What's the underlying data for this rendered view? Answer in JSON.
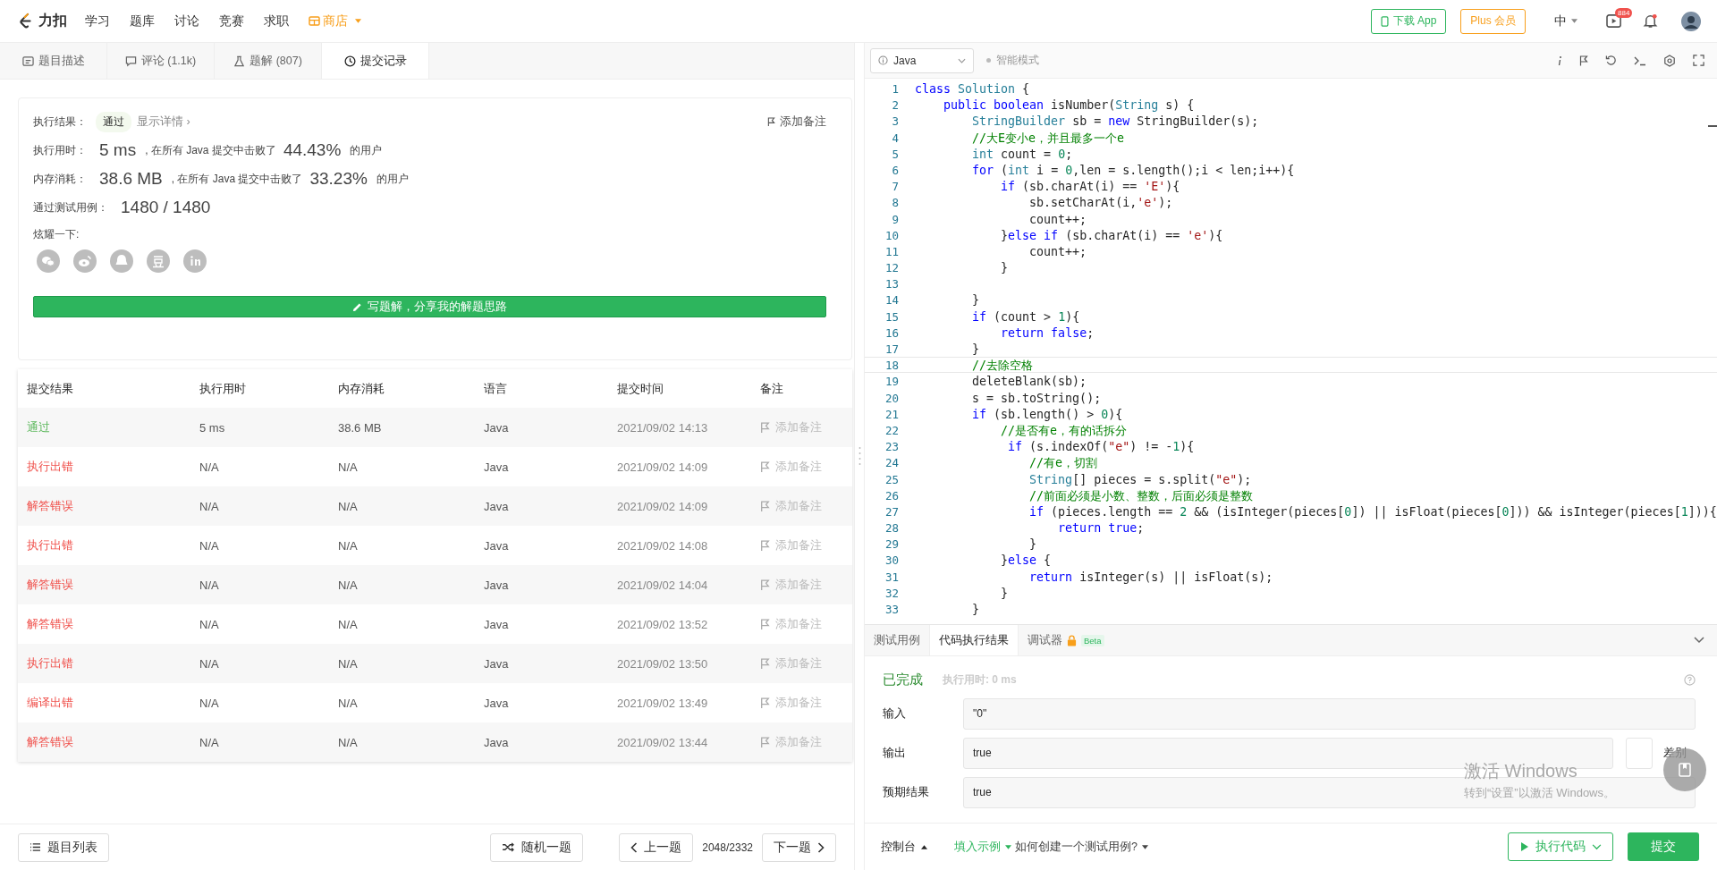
{
  "top_nav": {
    "brand": "力扣",
    "links": [
      {
        "label": "学习",
        "kind": "link"
      },
      {
        "label": "题库",
        "kind": "link"
      },
      {
        "label": "讨论",
        "kind": "link"
      },
      {
        "label": "竞赛",
        "kind": "link"
      },
      {
        "label": "求职",
        "kind": "link"
      },
      {
        "label": "商店",
        "kind": "store"
      }
    ],
    "download_button": "下载 App",
    "plus_button": "Plus 会员",
    "language": "中",
    "notification_badge": "884"
  },
  "problem_tabs": [
    {
      "label": "题目描述",
      "selected": false
    },
    {
      "label": "评论 (1.1k)",
      "selected": false
    },
    {
      "label": "题解 (807)",
      "selected": false
    },
    {
      "label": "提交记录",
      "selected": true
    }
  ],
  "result_card": {
    "result_label": "执行结果：",
    "result_badge": "通过",
    "details_link": "显示详情 ›",
    "note_link": "添加备注",
    "stats": [
      {
        "label": "执行用时：",
        "value": "5 ms",
        "middle": ", 在所有 Java 提交中击败了",
        "percent": "44.43%",
        "suffix": "的用户"
      },
      {
        "label": "内存消耗：",
        "value": "38.6 MB",
        "middle": ", 在所有 Java 提交中击败了",
        "percent": "33.23%",
        "suffix": "的用户"
      }
    ],
    "cases_label": "通过测试用例：",
    "cases_value": "1480 / 1480",
    "share_label": "炫耀一下:",
    "write_button": "写题解，分享我的解题思路"
  },
  "submissions": {
    "columns": [
      "提交结果",
      "执行用时",
      "内存消耗",
      "语言",
      "提交时间",
      "备注"
    ],
    "rows": [
      {
        "status": "通过",
        "color": "#5cb85c",
        "time": "5 ms",
        "memory": "38.6 MB",
        "language": "Java",
        "submitted": "2021/09/02 14:13",
        "note": "添加备注"
      },
      {
        "status": "执行出错",
        "color": "#f0514c",
        "time": "N/A",
        "memory": "N/A",
        "language": "Java",
        "submitted": "2021/09/02 14:09",
        "note": "添加备注"
      },
      {
        "status": "解答错误",
        "color": "#f0514c",
        "time": "N/A",
        "memory": "N/A",
        "language": "Java",
        "submitted": "2021/09/02 14:09",
        "note": "添加备注"
      },
      {
        "status": "执行出错",
        "color": "#f0514c",
        "time": "N/A",
        "memory": "N/A",
        "language": "Java",
        "submitted": "2021/09/02 14:08",
        "note": "添加备注"
      },
      {
        "status": "解答错误",
        "color": "#f0514c",
        "time": "N/A",
        "memory": "N/A",
        "language": "Java",
        "submitted": "2021/09/02 14:04",
        "note": "添加备注"
      },
      {
        "status": "解答错误",
        "color": "#f0514c",
        "time": "N/A",
        "memory": "N/A",
        "language": "Java",
        "submitted": "2021/09/02 13:52",
        "note": "添加备注"
      },
      {
        "status": "执行出错",
        "color": "#f0514c",
        "time": "N/A",
        "memory": "N/A",
        "language": "Java",
        "submitted": "2021/09/02 13:50",
        "note": "添加备注"
      },
      {
        "status": "编译出错",
        "color": "#f0514c",
        "time": "N/A",
        "memory": "N/A",
        "language": "Java",
        "submitted": "2021/09/02 13:49",
        "note": "添加备注"
      },
      {
        "status": "解答错误",
        "color": "#f0514c",
        "time": "N/A",
        "memory": "N/A",
        "language": "Java",
        "submitted": "2021/09/02 13:44",
        "note": "添加备注"
      }
    ]
  },
  "left_footer": {
    "list_button": "题目列表",
    "random_button": "随机一题",
    "prev_button": "上一题",
    "position": "2048/2332",
    "next_button": "下一题"
  },
  "editor": {
    "language": "Java",
    "mode": "智能模式",
    "lines": [
      {
        "number": "1",
        "current": false,
        "tokens": [
          {
            "kind": "keyword",
            "text": "class"
          },
          {
            "kind": "type",
            "text": " Solution"
          },
          {
            "kind": "plain",
            "text": " {"
          }
        ]
      },
      {
        "number": "2",
        "current": false,
        "tokens": [
          {
            "kind": "keyword",
            "text": "    public"
          },
          {
            "kind": "keyword",
            "text": " boolean"
          },
          {
            "kind": "plain",
            "text": " isNumber("
          },
          {
            "kind": "type",
            "text": "String"
          },
          {
            "kind": "plain",
            "text": " s) {"
          }
        ]
      },
      {
        "number": "3",
        "current": false,
        "tokens": [
          {
            "kind": "type",
            "text": "        StringBuilder"
          },
          {
            "kind": "plain",
            "text": " sb = "
          },
          {
            "kind": "keyword",
            "text": "new"
          },
          {
            "kind": "plain",
            "text": " StringBuilder(s);"
          }
        ]
      },
      {
        "number": "4",
        "current": false,
        "tokens": [
          {
            "kind": "comment",
            "text": "        //大E变小e，并且最多一个e"
          }
        ]
      },
      {
        "number": "5",
        "current": false,
        "tokens": [
          {
            "kind": "type",
            "text": "        int"
          },
          {
            "kind": "plain",
            "text": " count = "
          },
          {
            "kind": "number",
            "text": "0"
          },
          {
            "kind": "plain",
            "text": ";"
          }
        ]
      },
      {
        "number": "6",
        "current": false,
        "tokens": [
          {
            "kind": "keyword",
            "text": "        for"
          },
          {
            "kind": "plain",
            "text": " ("
          },
          {
            "kind": "type",
            "text": "int"
          },
          {
            "kind": "plain",
            "text": " i = "
          },
          {
            "kind": "number",
            "text": "0"
          },
          {
            "kind": "plain",
            "text": ",len = s.length();i < len;i++){"
          }
        ]
      },
      {
        "number": "7",
        "current": false,
        "tokens": [
          {
            "kind": "keyword",
            "text": "            if"
          },
          {
            "kind": "plain",
            "text": " (sb.charAt(i) == "
          },
          {
            "kind": "string",
            "text": "'E'"
          },
          {
            "kind": "plain",
            "text": "){"
          }
        ]
      },
      {
        "number": "8",
        "current": false,
        "tokens": [
          {
            "kind": "plain",
            "text": "                sb.setCharAt(i,"
          },
          {
            "kind": "string",
            "text": "'e'"
          },
          {
            "kind": "plain",
            "text": ");"
          }
        ]
      },
      {
        "number": "9",
        "current": false,
        "tokens": [
          {
            "kind": "plain",
            "text": "                count++;"
          }
        ]
      },
      {
        "number": "10",
        "current": false,
        "tokens": [
          {
            "kind": "plain",
            "text": "            }"
          },
          {
            "kind": "keyword",
            "text": "else"
          },
          {
            "kind": "keyword",
            "text": " if"
          },
          {
            "kind": "plain",
            "text": " (sb.charAt(i) == "
          },
          {
            "kind": "string",
            "text": "'e'"
          },
          {
            "kind": "plain",
            "text": "){"
          }
        ]
      },
      {
        "number": "11",
        "current": false,
        "tokens": [
          {
            "kind": "plain",
            "text": "                count++;"
          }
        ]
      },
      {
        "number": "12",
        "current": false,
        "tokens": [
          {
            "kind": "plain",
            "text": "            }"
          }
        ]
      },
      {
        "number": "13",
        "current": false
      },
      {
        "number": "14",
        "current": false,
        "tokens": [
          {
            "kind": "plain",
            "text": "        }"
          }
        ]
      },
      {
        "number": "15",
        "current": false,
        "tokens": [
          {
            "kind": "keyword",
            "text": "        if"
          },
          {
            "kind": "plain",
            "text": " (count > "
          },
          {
            "kind": "number",
            "text": "1"
          },
          {
            "kind": "plain",
            "text": "){"
          }
        ]
      },
      {
        "number": "16",
        "current": false,
        "tokens": [
          {
            "kind": "keyword",
            "text": "            return"
          },
          {
            "kind": "keyword",
            "text": " false"
          },
          {
            "kind": "plain",
            "text": ";"
          }
        ]
      },
      {
        "number": "17",
        "current": false,
        "tokens": [
          {
            "kind": "plain",
            "text": "        }"
          }
        ]
      },
      {
        "number": "18",
        "current": true,
        "tokens": [
          {
            "kind": "comment",
            "text": "        //去除空格"
          }
        ]
      },
      {
        "number": "19",
        "current": false,
        "tokens": [
          {
            "kind": "plain",
            "text": "        deleteBlank(sb);"
          }
        ]
      },
      {
        "number": "20",
        "current": false,
        "tokens": [
          {
            "kind": "plain",
            "text": "        s = sb.toString();"
          }
        ]
      },
      {
        "number": "21",
        "current": false,
        "tokens": [
          {
            "kind": "keyword",
            "text": "        if"
          },
          {
            "kind": "plain",
            "text": " (sb.length() > "
          },
          {
            "kind": "number",
            "text": "0"
          },
          {
            "kind": "plain",
            "text": "){"
          }
        ]
      },
      {
        "number": "22",
        "current": false,
        "tokens": [
          {
            "kind": "comment",
            "text": "            //是否有e，有的话拆分"
          }
        ]
      },
      {
        "number": "23",
        "current": false,
        "tokens": [
          {
            "kind": "keyword",
            "text": "             if"
          },
          {
            "kind": "plain",
            "text": " (s.indexOf("
          },
          {
            "kind": "string",
            "text": "\"e\""
          },
          {
            "kind": "plain",
            "text": ") != -"
          },
          {
            "kind": "number",
            "text": "1"
          },
          {
            "kind": "plain",
            "text": "){"
          }
        ]
      },
      {
        "number": "24",
        "current": false,
        "tokens": [
          {
            "kind": "comment",
            "text": "                //有e，切割"
          }
        ]
      },
      {
        "number": "25",
        "current": false,
        "tokens": [
          {
            "kind": "type",
            "text": "                String"
          },
          {
            "kind": "plain",
            "text": "[] pieces = s.split("
          },
          {
            "kind": "string",
            "text": "\"e\""
          },
          {
            "kind": "plain",
            "text": ");"
          }
        ]
      },
      {
        "number": "26",
        "current": false,
        "tokens": [
          {
            "kind": "comment",
            "text": "                //前面必须是小数、整数，后面必须是整数"
          }
        ]
      },
      {
        "number": "27",
        "current": false,
        "tokens": [
          {
            "kind": "keyword",
            "text": "                if"
          },
          {
            "kind": "plain",
            "text": " (pieces.length == "
          },
          {
            "kind": "number",
            "text": "2"
          },
          {
            "kind": "plain",
            "text": " && (isInteger(pieces["
          },
          {
            "kind": "number",
            "text": "0"
          },
          {
            "kind": "plain",
            "text": "]) || isFloat(pieces["
          },
          {
            "kind": "number",
            "text": "0"
          },
          {
            "kind": "plain",
            "text": "])) && isInteger(pieces["
          },
          {
            "kind": "number",
            "text": "1"
          },
          {
            "kind": "plain",
            "text": "])){"
          }
        ]
      },
      {
        "number": "28",
        "current": false,
        "tokens": [
          {
            "kind": "keyword",
            "text": "                    return"
          },
          {
            "kind": "keyword",
            "text": " true"
          },
          {
            "kind": "plain",
            "text": ";"
          }
        ]
      },
      {
        "number": "29",
        "current": false,
        "tokens": [
          {
            "kind": "plain",
            "text": "                }"
          }
        ]
      },
      {
        "number": "30",
        "current": false,
        "tokens": [
          {
            "kind": "plain",
            "text": "            }"
          },
          {
            "kind": "keyword",
            "text": "else"
          },
          {
            "kind": "plain",
            "text": " {"
          }
        ]
      },
      {
        "number": "31",
        "current": false,
        "tokens": [
          {
            "kind": "keyword",
            "text": "                return"
          },
          {
            "kind": "plain",
            "text": " isInteger(s) || isFloat(s);"
          }
        ]
      },
      {
        "number": "32",
        "current": false,
        "tokens": [
          {
            "kind": "plain",
            "text": "            }"
          }
        ]
      },
      {
        "number": "33",
        "current": false,
        "tokens": [
          {
            "kind": "plain",
            "text": "        }"
          }
        ]
      }
    ]
  },
  "console": {
    "tabs": [
      {
        "label": "测试用例",
        "selected": false,
        "locked": false
      },
      {
        "label": "代码执行结果",
        "selected": true,
        "locked": false
      },
      {
        "label": "调试器",
        "selected": false,
        "locked": true,
        "badge": "Beta"
      }
    ],
    "status": "已完成",
    "runtime": "执行用时: 0 ms",
    "fields": [
      {
        "label": "输入",
        "value": "\"0\""
      },
      {
        "label": "输出",
        "value": "true"
      },
      {
        "label": "预期结果",
        "value": "true"
      }
    ],
    "diff_label": "差别"
  },
  "right_footer": {
    "console_toggle": "控制台",
    "fill_example": "填入示例",
    "help_link": "如何创建一个测试用例?",
    "run_button": "执行代码",
    "submit_button": "提交"
  },
  "os_watermark": {
    "title": "激活 Windows",
    "subtitle": "转到“设置”以激活 Windows。"
  }
}
